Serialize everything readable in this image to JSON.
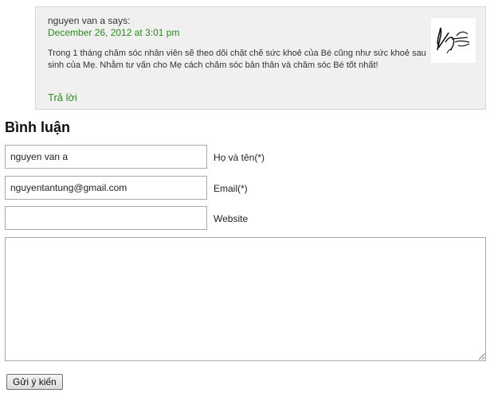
{
  "comment": {
    "author_line": "nguyen van a says:",
    "date": "December 26, 2012 at 3:01 pm",
    "text": "Trong 1 tháng chăm sóc nhân viên sẽ theo dõi chặt chẽ sức khoẻ của Bé cũng như sức khoẻ sau sinh của Mẹ. Nhằm tư vấn cho Mẹ cách chăm sóc bản thân và chăm sóc Bé tốt nhất!",
    "reply_label": "Trả lời",
    "avatar_icon": "signature-avatar-icon"
  },
  "form": {
    "title": "Bình luận",
    "name": {
      "value": "nguyen van a",
      "label": "Họ và tên(*)"
    },
    "email": {
      "value": "nguyentantung@gmail.com",
      "label": "Email(*)"
    },
    "website": {
      "value": "",
      "label": "Website"
    },
    "message": {
      "value": ""
    },
    "submit_label": "Gửi ý kiến"
  },
  "colors": {
    "link_green": "#2b8a1f",
    "comment_bg": "#f0f0f0"
  }
}
